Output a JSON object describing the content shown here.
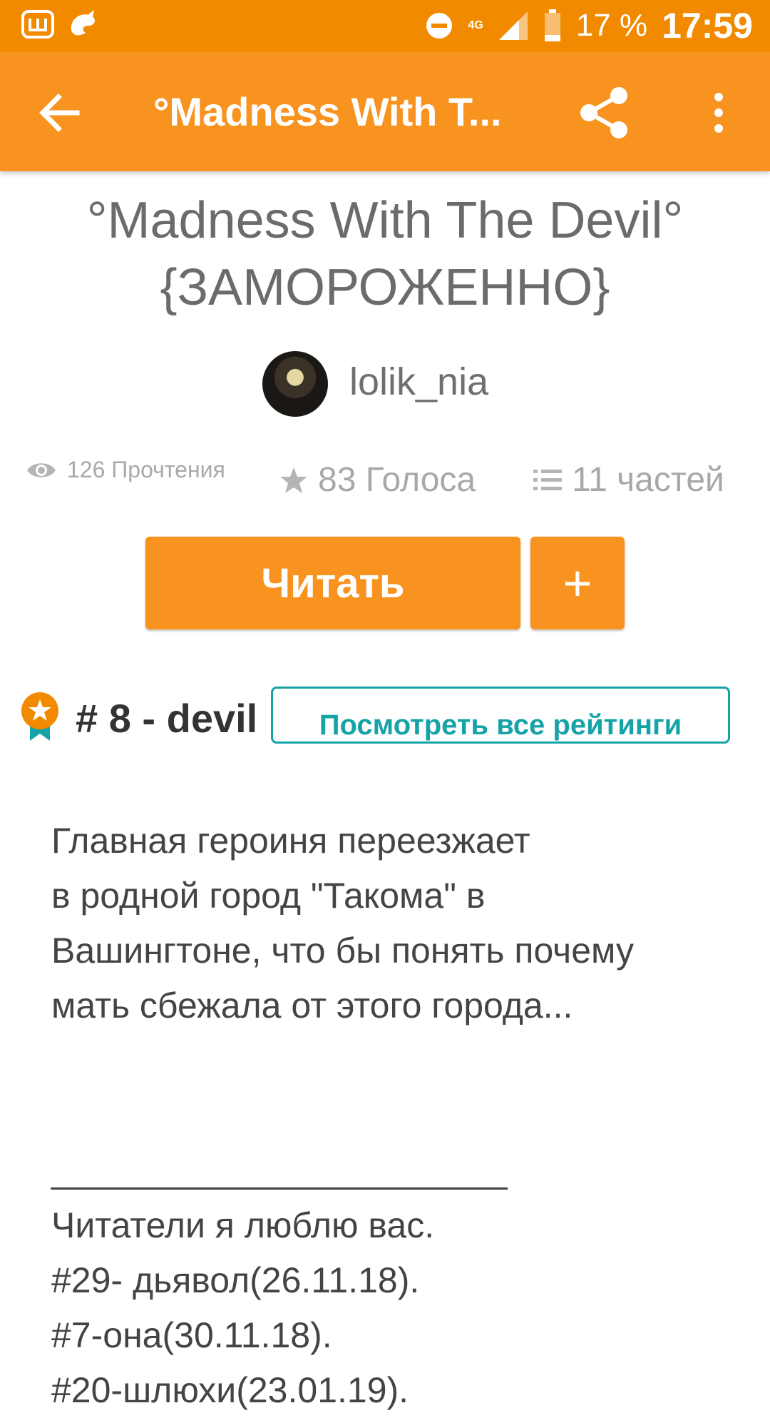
{
  "status_bar": {
    "network": "4G",
    "battery": "17 %",
    "time": "17:59",
    "icons": [
      "app-w-icon",
      "wattpad-icon",
      "do-not-disturb-icon",
      "signal-icon",
      "battery-icon"
    ]
  },
  "app_bar": {
    "title": "°Madness With T...",
    "back_icon": "arrow-left-icon",
    "share_icon": "share-icon",
    "more_icon": "more-vert-icon"
  },
  "story": {
    "title_line1": "°Madness With The Devil°",
    "title_line2": "{ЗАМОРОЖЕННО}",
    "author": "lolik_nia"
  },
  "stats": {
    "reads": "126 Прочтения",
    "votes": "83 Голоса",
    "parts": "11 частей"
  },
  "actions": {
    "read_label": "Читать",
    "add_label": "+"
  },
  "ranking": {
    "text": "# 8 - devil",
    "button_label": "Посмотреть все рейтинги"
  },
  "description": {
    "text": "Главная героиня переезжает\nв родной город \"Такома\" в\nВашингтоне, что бы понять почему\nмать сбежала от этого города...\n\n\n_______________________\nЧитатели я люблю вас.\n#29- дьявол(26.11.18).\n#7-она(30.11.18).\n#20-шлюхи(23.01.19)."
  },
  "colors": {
    "status_bar": "#f28a00",
    "app_bar": "#f7931e",
    "accent_teal": "#16a3a8"
  }
}
